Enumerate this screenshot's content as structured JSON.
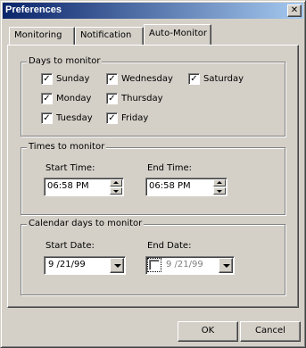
{
  "window": {
    "title": "Preferences",
    "close_glyph": "✕"
  },
  "tabs": [
    {
      "label": "Monitoring",
      "active": false
    },
    {
      "label": "Notification",
      "active": false
    },
    {
      "label": "Auto-Monitor",
      "active": true
    }
  ],
  "days_group": {
    "label": "Days to monitor",
    "days": [
      {
        "label": "Sunday",
        "checked": true
      },
      {
        "label": "Monday",
        "checked": true
      },
      {
        "label": "Tuesday",
        "checked": true
      },
      {
        "label": "Wednesday",
        "checked": true
      },
      {
        "label": "Thursday",
        "checked": true
      },
      {
        "label": "Friday",
        "checked": true
      },
      {
        "label": "Saturday",
        "checked": true
      }
    ],
    "check_glyph": "✓"
  },
  "times_group": {
    "label": "Times to monitor",
    "start_label": "Start Time:",
    "start_value": "06:58 PM",
    "end_label": "End Time:",
    "end_value": "06:58 PM"
  },
  "calendar_group": {
    "label": "Calendar days to monitor",
    "start_label": "Start Date:",
    "start_value": "9 /21/99",
    "end_label": "End Date:",
    "end_value": "9 /21/99",
    "end_enabled": false
  },
  "buttons": {
    "ok": "OK",
    "cancel": "Cancel"
  },
  "colors": {
    "face": "#d4d0c8",
    "title_start": "#0a246a",
    "title_end": "#a6caf0",
    "disabled_text": "#808080"
  }
}
